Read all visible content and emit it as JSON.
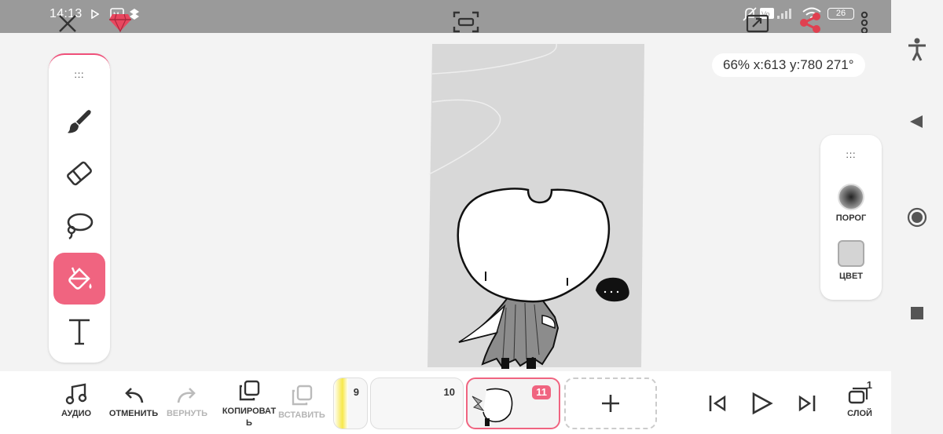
{
  "status": {
    "time": "14:13",
    "battery": "26"
  },
  "canvas": {
    "info": "66% x:613 y:780 271°"
  },
  "tools": [
    {
      "name": "brush",
      "icon": "brush-icon"
    },
    {
      "name": "eraser",
      "icon": "eraser-icon"
    },
    {
      "name": "lasso",
      "icon": "lasso-icon"
    },
    {
      "name": "fill",
      "icon": "paint-bucket-icon",
      "active": true
    },
    {
      "name": "text",
      "icon": "text-icon"
    }
  ],
  "right_panel": {
    "threshold_label": "ПОРОГ",
    "color_label": "ЦВЕТ"
  },
  "bottom": {
    "audio_label": "АУДИО",
    "undo_label": "ОТМЕНИТЬ",
    "redo_label": "ВЕРНУТЬ",
    "copy_label": "КОПИРОВАТ\nЬ",
    "paste_label": "ВСТАВИТЬ",
    "layer_label": "СЛОЙ",
    "layer_count": "1",
    "frames": [
      {
        "num": "9"
      },
      {
        "num": "10"
      },
      {
        "num": "11",
        "active": true
      }
    ]
  },
  "colors": {
    "accent": "#f06480",
    "status_bar": "#9a9a9a"
  }
}
